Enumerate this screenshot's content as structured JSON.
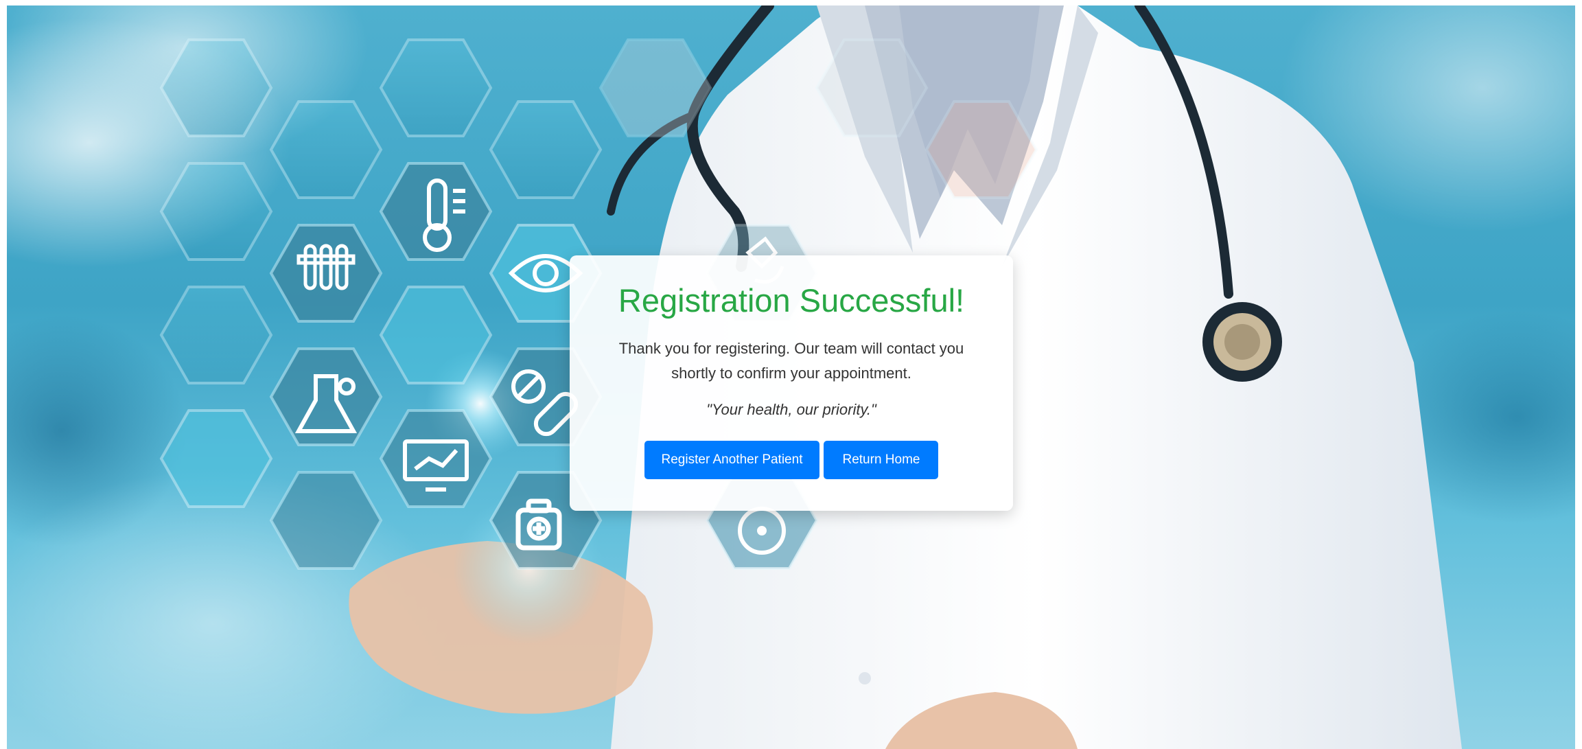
{
  "card": {
    "title": "Registration Successful!",
    "message": "Thank you for registering. Our team will contact you shortly to confirm your appointment.",
    "slogan": "\"Your health, our priority.\"",
    "buttons": {
      "register_another": "Register Another Patient",
      "return_home": "Return Home"
    }
  },
  "colors": {
    "title": "#28a745",
    "button": "#007bff"
  },
  "background_icons": [
    "thermometer-icon",
    "test-tubes-icon",
    "eye-icon",
    "microscope-icon",
    "flask-icon",
    "pills-icon",
    "monitor-chart-icon",
    "first-aid-kit-icon",
    "cd-icon"
  ]
}
